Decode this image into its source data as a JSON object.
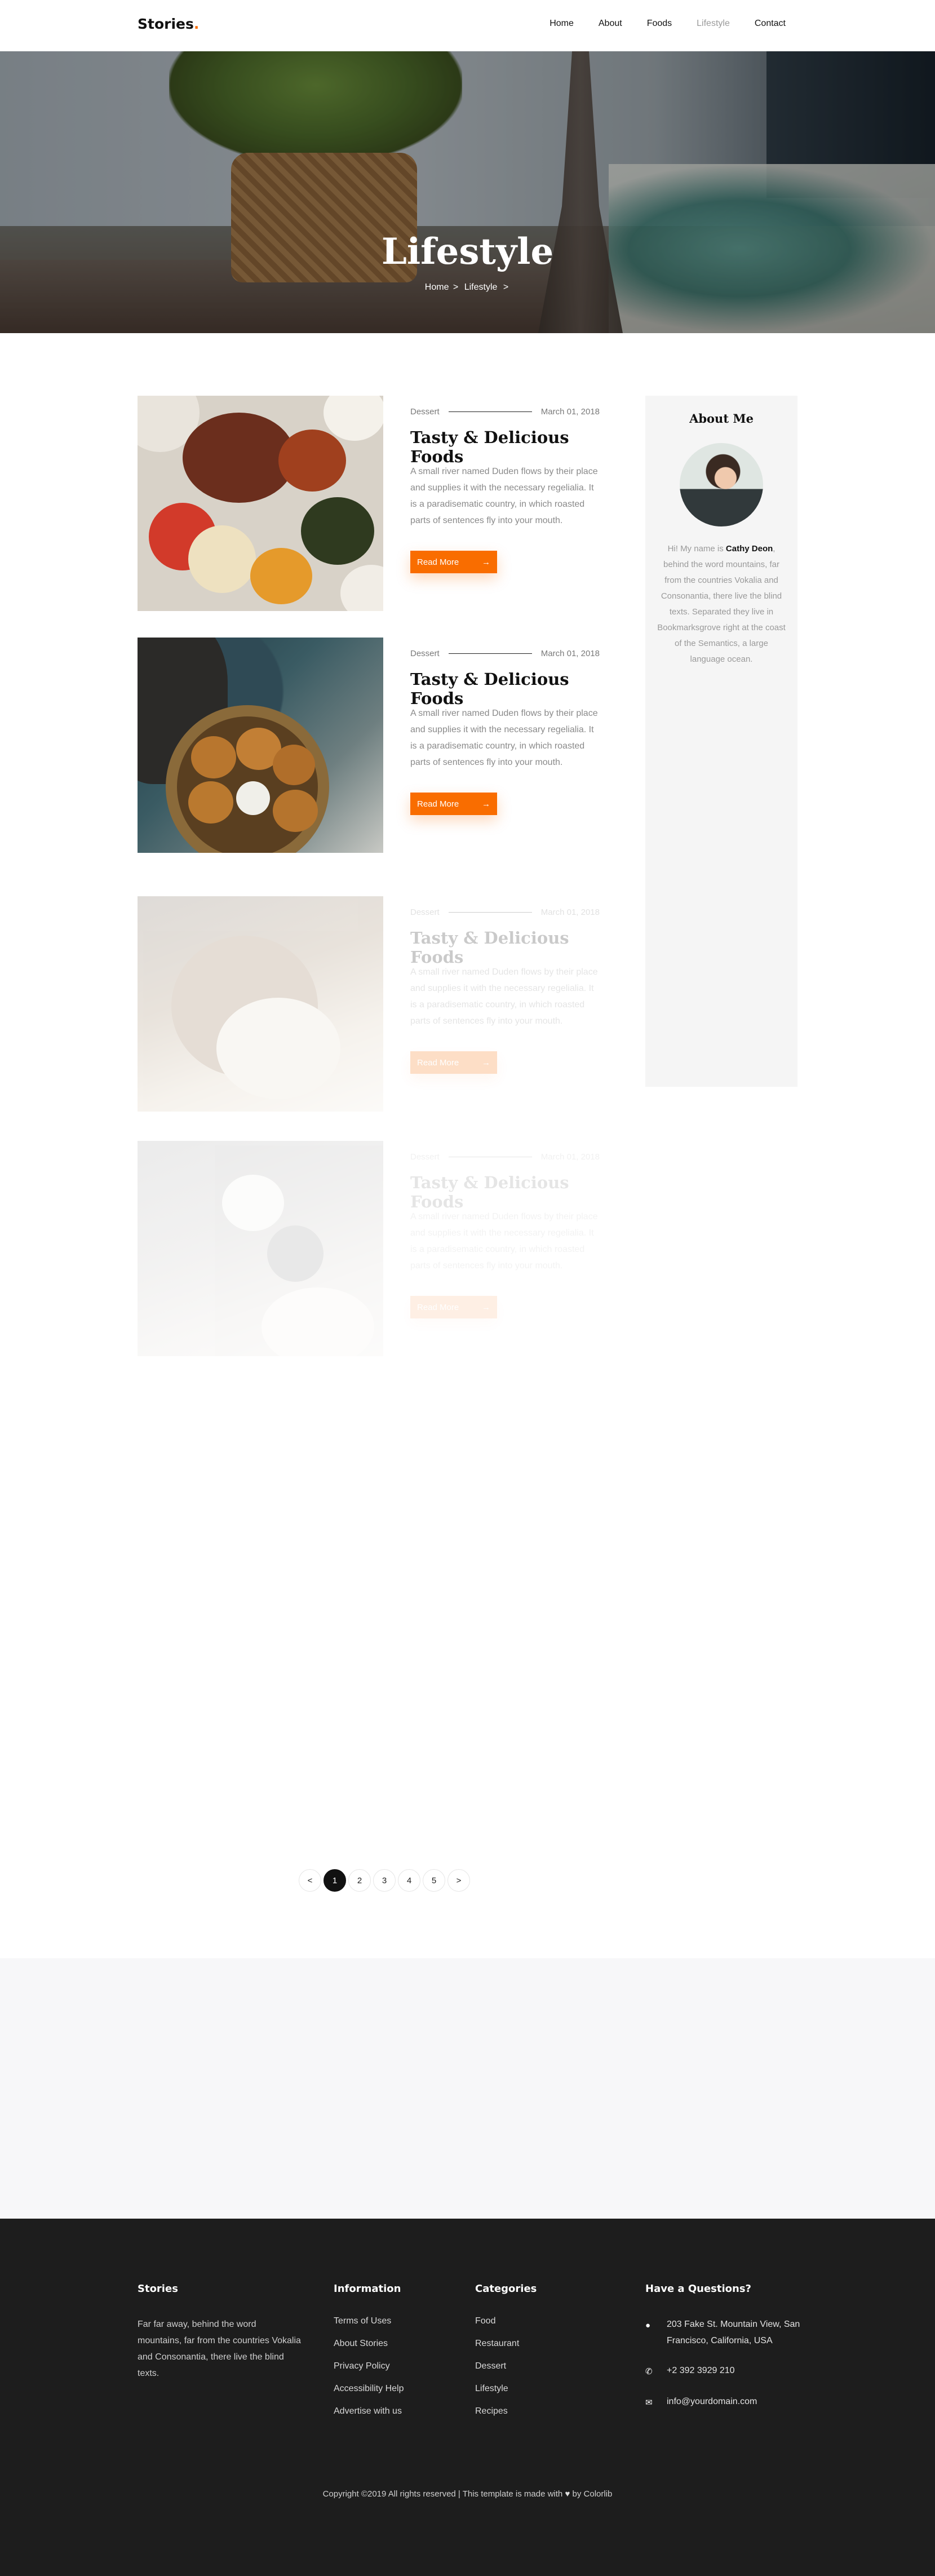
{
  "brand": {
    "name": "Stories",
    "dot": "."
  },
  "nav": {
    "items": [
      {
        "label": "Home"
      },
      {
        "label": "About"
      },
      {
        "label": "Foods"
      },
      {
        "label": "Lifestyle"
      },
      {
        "label": "Contact"
      }
    ],
    "active": "Lifestyle"
  },
  "hero": {
    "title": "Lifestyle",
    "breadcrumb": [
      "Home",
      ">",
      "Lifestyle",
      ">"
    ]
  },
  "posts": [
    {
      "category": "Dessert",
      "date": "March 01, 2018",
      "title": "Tasty & Delicious Foods",
      "excerpt": "A small river named Duden flows by their place and supplies it with the necessary regelialia. It is a paradisematic country, in which roasted parts of sentences fly into your mouth.",
      "cta": "Read More",
      "arrow": "→"
    },
    {
      "category": "Dessert",
      "date": "March 01, 2018",
      "title": "Tasty & Delicious Foods",
      "excerpt": "A small river named Duden flows by their place and supplies it with the necessary regelialia. It is a paradisematic country, in which roasted parts of sentences fly into your mouth.",
      "cta": "Read More",
      "arrow": "→"
    },
    {
      "category": "Dessert",
      "date": "March 01, 2018",
      "title": "Tasty & Delicious Foods",
      "excerpt": "A small river named Duden flows by their place and supplies it with the necessary regelialia. It is a paradisematic country, in which roasted parts of sentences fly into your mouth.",
      "cta": "Read More",
      "arrow": "→"
    },
    {
      "category": "Dessert",
      "date": "March 01, 2018",
      "title": "Tasty & Delicious Foods",
      "excerpt": "A small river named Duden flows by their place and supplies it with the necessary regelialia. It is a paradisematic country, in which roasted parts of sentences fly into your mouth.",
      "cta": "Read More",
      "arrow": "→"
    }
  ],
  "sidebar": {
    "heading": "About Me",
    "intro": "Hi! My name is",
    "name": "Cathy Deon",
    "text": ", behind the word mountains, far from the countries Vokalia and Consonantia, there live the blind texts. Separated they live in Bookmarksgrove right at the coast of the Semantics, a large language ocean."
  },
  "pagination": {
    "prev": "<",
    "pages": [
      "1",
      "2",
      "3",
      "4",
      "5"
    ],
    "next": ">",
    "current": "1"
  },
  "footer": {
    "about": {
      "heading": "Stories",
      "text": "Far far away, behind the word mountains, far from the countries Vokalia and Consonantia, there live the blind texts."
    },
    "information": {
      "heading": "Information",
      "links": [
        "Terms of Uses",
        "About Stories",
        "Privacy Policy",
        "Accessibility Help",
        "Advertise with us"
      ]
    },
    "categories": {
      "heading": "Categories",
      "links": [
        "Food",
        "Restaurant",
        "Dessert",
        "Lifestyle",
        "Recipes"
      ]
    },
    "contact": {
      "heading": "Have a Questions?",
      "address": "203 Fake St. Mountain View, San Francisco, California, USA",
      "phone": "+2 392 3929 210",
      "email": "info@yourdomain.com"
    },
    "copyright_pre": "Copyright ©2019 All rights reserved | This template is made with",
    "copyright_post": "by Colorlib"
  },
  "colors": {
    "accent": "#f96d00",
    "footer_bg": "#1d1d1d",
    "sidebar_bg": "#f5f5f5"
  }
}
